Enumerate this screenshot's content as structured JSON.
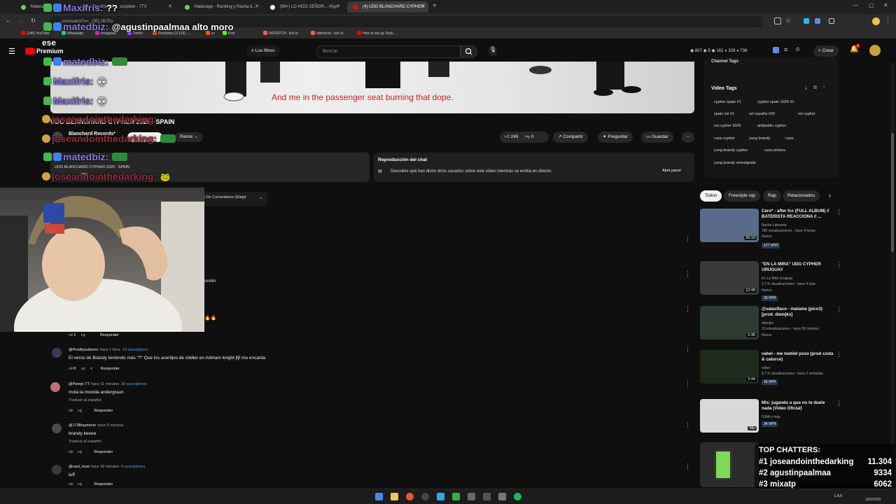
{
  "browser": {
    "tabs": [
      {
        "label": "Matecapp",
        "color": "#7ac74f"
      },
      {
        "label": "Maxifris: ?? ... scription - 7TV",
        "color": "#29b6f6"
      },
      {
        "label": "Matecapp - Ranking y Racha d...",
        "color": "#7ac74f"
      },
      {
        "label": "(99+) LO HIZO SEÑOR... #fyp",
        "color": "#ffffff"
      },
      {
        "label": "(4) UDG BLANCHARD CYPHER",
        "color": "#ff0000"
      }
    ],
    "url": "com/watch?v=...OEL2B7Ee",
    "bookmarks": [
      "(146) YouTube",
      "WhatsApp",
      "Instagram",
      "Twitch",
      "Recibidos (3.119) -...",
      "sc",
      "Kick",
      "IAFFEFCH - itch.io",
      "oddnerve - itch.io",
      "How to set up Tools..."
    ]
  },
  "youtube": {
    "premium_label": "Premium",
    "filters_label": "Los filtros",
    "search_placeholder": "Buscar",
    "create_label": "Crear",
    "notif_count": "4",
    "stats": {
      "a": "807",
      "b": "5",
      "c": "161",
      "d": "329",
      "e": "736"
    }
  },
  "video": {
    "lyrics": "And me in the passenger seat burning that dope.",
    "title": "UDG BLANCHARD CYPHER 2026 - SPAIN",
    "channel": "Blanchard Records*",
    "remix_label": "Remix",
    "likes": "245",
    "dislikes": "0",
    "share_label": "Compartir",
    "ask_label": "Preguntar",
    "save_label": "Guardar",
    "desc_title": "UDG BLANCHARD CYPHER 2026 - SPAIN",
    "desc_more": "más",
    "chat_replay_title": "Reproducción del chat",
    "chat_replay_desc": "Descubre qué han dicho otros usuarios sobre este vídeo mientras se emitía en directo.",
    "chat_replay_btn": "Abrir panel",
    "sort_label": "a De Comentarios (Elegir",
    "partial_text": "under"
  },
  "sidebar": {
    "channel_tags": "Channel Tags",
    "video_tags_title": "Video Tags",
    "tags": [
      "cypher spain #1",
      "cypher spain 2026 #1",
      "spain xxl #1",
      "xxl españa #32",
      "xxl cypher",
      "xxl cypher 2026",
      "antipublic cypher",
      "caos cypher",
      "yung brandy",
      "caos",
      "yung brandy cypher",
      "caos pintura",
      "yung brandy amesignale"
    ],
    "chips": [
      "Todos",
      "Freestyle rap",
      "Rap",
      "Relacionados"
    ],
    "recs": [
      {
        "title": "Cero* - after fcc (FULL ALBUM) // BATERISTA REACCIONA // ...",
        "channel": "Nacho Lahuerta",
        "meta": "782 visualizaciones · hace 4 horas",
        "badge": "Nuevo",
        "vph": "177 VPH",
        "dur": "26:10",
        "color": "#5a6b8a"
      },
      {
        "title": "\"EN LA MIRA\" UDG CYPHER URUGUAY",
        "channel": "En La Mira Uruguay",
        "meta": "3,7 K visualizaciones · hace 4 días",
        "badge": "Nuevo",
        "vph": "33 VPH",
        "dur": "12:49",
        "color": "#3a3a3a"
      },
      {
        "title": "@salasflaco - matame (pico3) [prod. diemjks]",
        "channel": "diemjks",
        "meta": "13 visualizaciones · hace 36 minutos",
        "badge": "Nuevo",
        "vph": "",
        "dur": "2:35",
        "color": "#2f3a33"
      },
      {
        "title": "vahel - me meti/el pozo (prod czeta & catorce)",
        "channel": "vahel",
        "meta": "8,7 K visualizaciones · hace 2 semanas",
        "badge": "",
        "vph": "16 VPH",
        "dur": "2:44",
        "color": "#1f2a1c"
      },
      {
        "title": "Mix: jugando a que no te duele nada (Video Oficial)",
        "channel": "ISMA y más",
        "meta": "",
        "badge": "",
        "vph": "34 VPH",
        "dur": "Mix",
        "color": "#d8d8d8"
      }
    ]
  },
  "comments": [
    {
      "name": "@Prodbysubzero",
      "time": "hace 1 hora",
      "subs": "13 suscriptores",
      "text": "El verso de Brandy teniendo más \"?\" Que los acertijos de riddler en Arkham knight jfjf me encanta",
      "likes": "8",
      "trans": ""
    },
    {
      "name": "@Parejo-TT",
      "time": "hace 11 minutos",
      "subs": "38 suscriptores",
      "text": "mola la movida andergraun",
      "likes": "",
      "trans": "Traducir al español"
    },
    {
      "name": "@1738raymone",
      "time": "hace 5 minutos",
      "subs": "",
      "text": "brandy keeee",
      "likes": "",
      "trans": "Traducir al español"
    },
    {
      "name": "@cant_trust",
      "time": "hace 18 minutos",
      "subs": "5 suscriptores",
      "text": "tuff",
      "likes": "",
      "trans": ""
    }
  ],
  "reply_label": "Responder",
  "first_likes": "1",
  "stream": {
    "chat": [
      {
        "user": "Maxifris:",
        "msg": "??",
        "color": "#8a7bd8"
      },
      {
        "user": "matedbiz:",
        "msg": "@agustinpaalmaa alto moro",
        "color": "#8a7bd8"
      },
      {
        "user": "",
        "msg": "ese",
        "color": "#ffffff"
      },
      {
        "user": "matedbiz:",
        "msg": "",
        "color": "#8a7bd8"
      },
      {
        "user": "Maxifris:",
        "msg": "",
        "color": "#8a7bd8"
      },
      {
        "user": "Maxifris:",
        "msg": "",
        "color": "#8a7bd8"
      },
      {
        "user": "joseandointhedarking:",
        "msg": "",
        "color": "#a0283c"
      },
      {
        "user": "joseandointhedarking:",
        "msg": "",
        "color": "#a0283c"
      },
      {
        "user": "matedbiz:",
        "msg": "",
        "color": "#8a7bd8"
      },
      {
        "user": "joseandointhedarking:",
        "msg": "",
        "color": "#a0283c"
      }
    ],
    "top_chatters_title": "TOP CHATTERS:",
    "top_chatters": [
      {
        "rank": "#1",
        "name": "joseandointhedarking",
        "value": "11.304"
      },
      {
        "rank": "#2",
        "name": "agustinpaalmaa",
        "value": "9334"
      },
      {
        "rank": "#3",
        "name": "mixatp",
        "value": "6062"
      }
    ]
  },
  "taskbar": {
    "clock": "19/2/2026",
    "lang": "LAA"
  }
}
